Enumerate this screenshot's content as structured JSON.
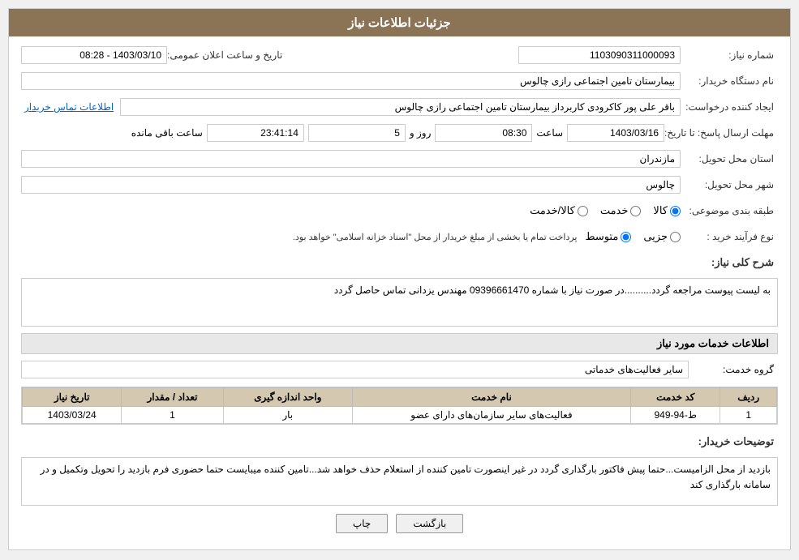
{
  "header": {
    "title": "جزئیات اطلاعات نیاز"
  },
  "fields": {
    "need_number_label": "شماره نیاز:",
    "need_number_value": "1103090311000093",
    "org_name_label": "نام دستگاه خریدار:",
    "org_name_value": "بیمارستان تامین اجتماعی رازی چالوس",
    "creator_label": "ایجاد کننده درخواست:",
    "creator_value": "باقر علی پور کاکرودی کاربرداز بیمارستان تامین اجتماعی رازی چالوس",
    "creator_link": "اطلاعات تماس خریدار",
    "deadline_label": "مهلت ارسال پاسخ: تا تاریخ:",
    "deadline_date": "1403/03/16",
    "deadline_time_label": "ساعت",
    "deadline_time": "08:30",
    "deadline_day_label": "روز و",
    "deadline_days": "5",
    "deadline_remaining_label": "ساعت باقی مانده",
    "deadline_remaining": "23:41:14",
    "province_label": "استان محل تحویل:",
    "province_value": "مازندران",
    "city_label": "شهر محل تحویل:",
    "city_value": "چالوس",
    "category_label": "طبقه بندی موضوعی:",
    "category_options": [
      "کالا",
      "خدمت",
      "کالا/خدمت"
    ],
    "category_selected": "کالا",
    "process_label": "نوع فرآیند خرید :",
    "process_options": [
      "جزیی",
      "متوسط"
    ],
    "process_note": "پرداخت تمام یا بخشی از مبلغ خریدار از محل \"اسناد خزانه اسلامی\" خواهد بود.",
    "announcement_label": "تاریخ و ساعت اعلان عمومی:",
    "announcement_value": "1403/03/10 - 08:28",
    "description_label": "شرح کلی نیاز:",
    "description_value": "به لیست پیوست مراجعه گردد..........در صورت نیاز با شماره 09396661470 مهندس یزدانی تماس حاصل گردد",
    "services_section": "اطلاعات خدمات مورد نیاز",
    "service_group_label": "گروه خدمت:",
    "service_group_value": "سایر فعالیت‌های خدماتی",
    "table": {
      "headers": [
        "ردیف",
        "کد خدمت",
        "نام خدمت",
        "واحد اندازه گیری",
        "تعداد / مقدار",
        "تاریخ نیاز"
      ],
      "rows": [
        {
          "row": "1",
          "code": "ط-94-949",
          "name": "فعالیت‌های سایر سازمان‌های دارای عضو",
          "unit": "بار",
          "quantity": "1",
          "date": "1403/03/24"
        }
      ]
    },
    "buyer_notes_label": "توضیحات خریدار:",
    "buyer_notes_value": "بازدید از محل الزامیست...حتما پیش فاکتور بارگذاری گردد در غیر اینصورت تامین کننده از استعلام حذف خواهد شد...تامین کننده میبایست حتما حضوری فرم بازدید را تحویل وتکمیل و در سامانه بارگذاری کند",
    "back_button": "بازگشت",
    "print_button": "چاپ"
  }
}
